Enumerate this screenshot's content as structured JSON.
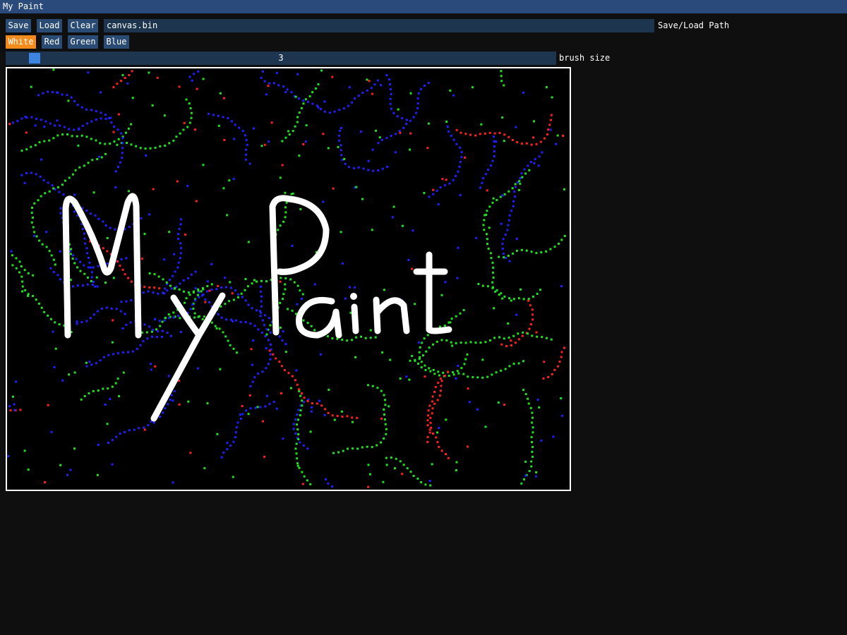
{
  "window": {
    "title": "My Paint"
  },
  "toolbar": {
    "save_label": "Save",
    "load_label": "Load",
    "clear_label": "Clear",
    "path_value": "canvas.bin",
    "path_label": "Save/Load Path"
  },
  "colors": {
    "white_label": "White",
    "red_label": "Red",
    "green_label": "Green",
    "blue_label": "Blue",
    "selected": "White",
    "accent": "#f28a1c",
    "button_bg": "#2a4b73"
  },
  "brush": {
    "label": "brush size",
    "value": "3"
  },
  "canvas": {
    "background": "#000000",
    "drawn_text": "My Paint",
    "stroke_colors": {
      "white": "#ffffff",
      "red": "#ff2020",
      "green": "#20e020",
      "blue": "#2020ff"
    }
  }
}
